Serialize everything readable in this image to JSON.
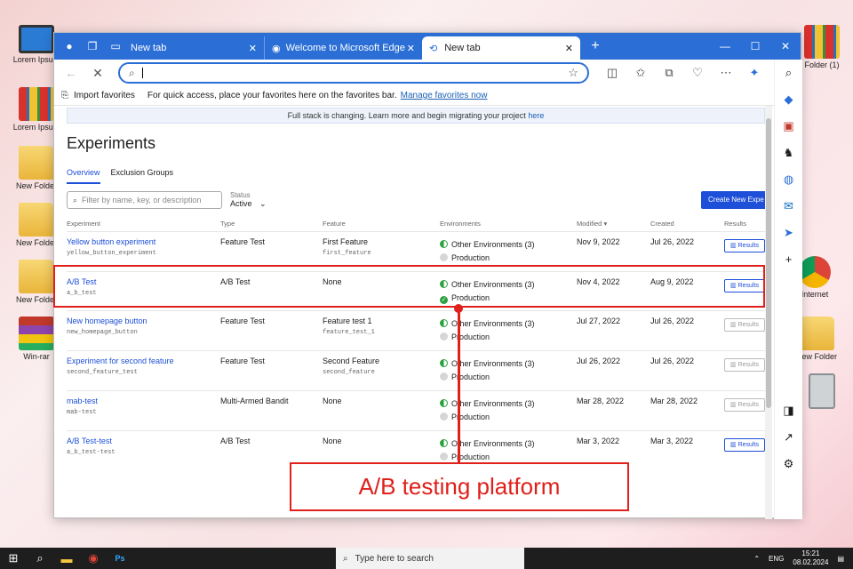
{
  "desktop": {
    "icons": [
      {
        "label": "Lorem Ipsum",
        "kind": "monitor"
      },
      {
        "label": "Lorem Ipsum",
        "kind": "binder"
      },
      {
        "label": "New Folder",
        "kind": "folder"
      },
      {
        "label": "New Folder",
        "kind": "folder"
      },
      {
        "label": "New Folder",
        "kind": "folder"
      },
      {
        "label": "Win-rar",
        "kind": "winrar"
      }
    ],
    "right_icons": [
      {
        "label": "Folder (1)",
        "kind": "binder"
      },
      {
        "label": "Internet",
        "kind": "chrome"
      },
      {
        "label": "New Folder",
        "kind": "folder"
      }
    ]
  },
  "browser": {
    "tabs": [
      {
        "label": "New tab",
        "active": false
      },
      {
        "label": "Welcome to Microsoft Edge",
        "active": false
      },
      {
        "label": "New tab",
        "active": true
      }
    ],
    "favbar": {
      "import": "Import favorites",
      "message": "For quick access, place your favorites here on the favorites bar.",
      "link": "Manage favorites now"
    }
  },
  "app": {
    "banner_text": "Full stack is changing. Learn more and begin migrating your project",
    "banner_link": "here",
    "title": "Experiments",
    "tabs": [
      "Overview",
      "Exclusion Groups"
    ],
    "filter_placeholder": "Filter by name, key, or description",
    "status_label": "Status",
    "status_value": "Active",
    "create_button": "Create New Expe",
    "columns": [
      "Experiment",
      "Type",
      "Feature",
      "Environments",
      "Modified",
      "Created",
      "Results"
    ],
    "rows": [
      {
        "name": "Yellow button experiment",
        "key": "yellow_button_experiment",
        "type": "Feature Test",
        "feature": "First Feature",
        "feature_key": "first_feature",
        "env1": "Other Environments (3)",
        "env2": "Production",
        "prod_ok": false,
        "modified": "Nov 9, 2022",
        "created": "Jul 26, 2022",
        "results": "Results",
        "results_active": true
      },
      {
        "name": "A/B Test",
        "key": "a_b_test",
        "type": "A/B Test",
        "feature": "None",
        "feature_key": "",
        "env1": "Other Environments (3)",
        "env2": "Production",
        "prod_ok": true,
        "modified": "Nov 4, 2022",
        "created": "Aug 9, 2022",
        "results": "Results",
        "results_active": true
      },
      {
        "name": "New homepage button",
        "key": "new_homepage_button",
        "type": "Feature Test",
        "feature": "Feature test 1",
        "feature_key": "feature_test_1",
        "env1": "Other Environments (3)",
        "env2": "Production",
        "prod_ok": false,
        "modified": "Jul 27, 2022",
        "created": "Jul 26, 2022",
        "results": "Results",
        "results_active": false
      },
      {
        "name": "Experiment for second feature",
        "key": "second_feature_test",
        "type": "Feature Test",
        "feature": "Second Feature",
        "feature_key": "second_feature",
        "env1": "Other Environments (3)",
        "env2": "Production",
        "prod_ok": false,
        "modified": "Jul 26, 2022",
        "created": "Jul 26, 2022",
        "results": "Results",
        "results_active": false
      },
      {
        "name": "mab-test",
        "key": "mab-test",
        "type": "Multi-Armed Bandit",
        "feature": "None",
        "feature_key": "",
        "env1": "Other Environments (3)",
        "env2": "Production",
        "prod_ok": false,
        "modified": "Mar 28, 2022",
        "created": "Mar 28, 2022",
        "results": "Results",
        "results_active": false
      },
      {
        "name": "A/B Test-test",
        "key": "a_b_test-test",
        "type": "A/B Test",
        "feature": "None",
        "feature_key": "",
        "env1": "Other Environments (3)",
        "env2": "Production",
        "prod_ok": false,
        "modified": "Mar 3, 2022",
        "created": "Mar 3, 2022",
        "results": "Results",
        "results_active": true
      }
    ]
  },
  "callout": "A/B testing platform",
  "taskbar": {
    "search_placeholder": "Type here to search",
    "lang": "ENG",
    "time": "15:21",
    "date": "08.02.2024"
  }
}
